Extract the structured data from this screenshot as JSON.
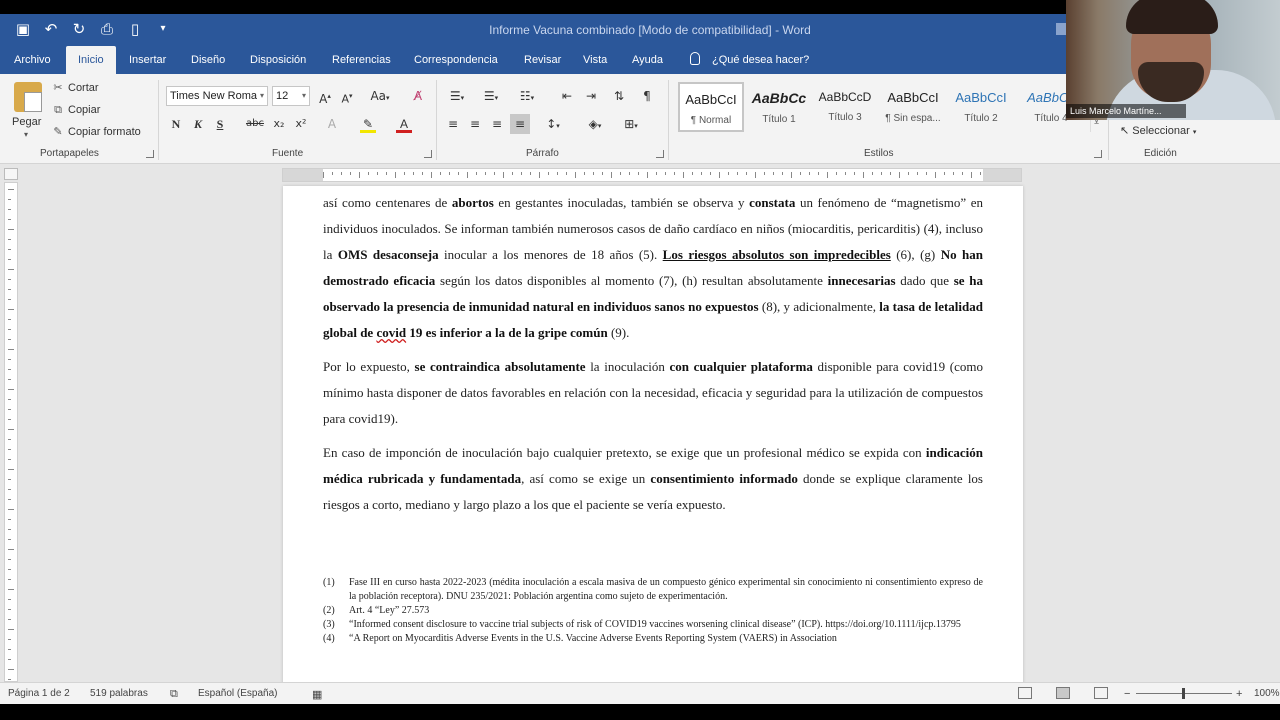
{
  "title_bar": {
    "document_title": "Informe Vacuna combinado [Modo de compatibilidad] - Word"
  },
  "quick_access": [
    "save-icon",
    "undo-icon",
    "redo-icon",
    "print-preview-icon",
    "new-document-icon",
    "customize-caret-icon"
  ],
  "tabs": [
    {
      "label": "Archivo"
    },
    {
      "label": "Inicio",
      "active": true
    },
    {
      "label": "Insertar"
    },
    {
      "label": "Diseño"
    },
    {
      "label": "Disposición"
    },
    {
      "label": "Referencias"
    },
    {
      "label": "Correspondencia"
    },
    {
      "label": "Revisar"
    },
    {
      "label": "Vista"
    },
    {
      "label": "Ayuda"
    }
  ],
  "tell_me": "¿Qué desea hacer?",
  "clipboard": {
    "paste": "Pegar",
    "cut": "Cortar",
    "copy": "Copiar",
    "format_painter": "Copiar formato",
    "group": "Portapapeles"
  },
  "font": {
    "name": "Times New Roma",
    "size": "12",
    "group": "Fuente",
    "bold": "N",
    "italic": "K",
    "underline": "S",
    "strike": "abc",
    "subscript": "x₂",
    "superscript": "x²",
    "change_case": "Aa",
    "highlight_color": "#f2e600",
    "font_color": "#d02020"
  },
  "paragraph": {
    "group": "Párrafo"
  },
  "styles": {
    "group": "Estilos",
    "items": [
      {
        "preview": "AaBbCcI",
        "name": "¶ Normal",
        "selected": true
      },
      {
        "preview": "AaBbCc",
        "name": "Título 1"
      },
      {
        "preview": "AaBbCcD",
        "name": "Título 3"
      },
      {
        "preview": "AaBbCcI",
        "name": "¶ Sin espa..."
      },
      {
        "preview": "AaBbCcI",
        "name": "Título 2"
      },
      {
        "preview": "AaBbCc",
        "name": "Título 4"
      }
    ]
  },
  "editing": {
    "select": "Seleccionar",
    "group": "Edición"
  },
  "document": {
    "p1_text1": "así como centenares de ",
    "p1_b1": "abortos",
    "p1_text2": " en gestantes inoculadas, también se observa y ",
    "p1_b2": "constata",
    "p1_text3": " un fenómeno de “magnetismo” en individuos inoculados. Se informan también numerosos casos de daño cardíaco en niños (miocarditis, pericarditis) (4), incluso la ",
    "p1_b3": "OMS desaconseja",
    "p1_text4": " inocular a los menores de 18 años (5). ",
    "p1_bu1": "Los riesgos absolutos son impredecibles",
    "p1_text5": " (6), (g) ",
    "p1_b4": "No han demostrado eficacia",
    "p1_text6": " según los datos disponibles al momento (7), (h) resultan absolutamente ",
    "p1_b5": "innecesarias",
    "p1_text7": " dado que ",
    "p1_b6": "se ha observado la presencia de inmunidad natural en individuos sanos no expuestos",
    "p1_text8": " (8), y adicionalmente, ",
    "p1_b7a": "la tasa de letalidad global de ",
    "p1_b7err": "covid",
    "p1_b7b": " 19 es inferior a la de la gripe común",
    "p1_text9": " (9).",
    "p2_text1": "Por lo expuesto, ",
    "p2_b1": "se contraindica absolutamente",
    "p2_text2": " la inoculación ",
    "p2_b2": "con cualquier plataforma",
    "p2_text3": " disponible para covid19 (como mínimo hasta disponer de datos favorables en relación con la necesidad, eficacia y seguridad para la utilización de compuestos para covid19).",
    "p3_text1": "En caso de imponción de inoculación bajo cualquier pretexto, se exige que un profesional médico se expida con ",
    "p3_b1": "indicación médica rubricada y fundamentada",
    "p3_text2": ", así como se exige un ",
    "p3_b2": "consentimiento informado",
    "p3_text3": " donde se explique claramente los riesgos a corto, mediano y largo plazo a los que el paciente se vería expuesto.",
    "refs": [
      {
        "num": "(1)",
        "text": "Fase III en curso hasta 2022-2023 (médita inoculación a escala masiva de un compuesto génico experimental sin conocimiento ni consentimiento expreso de la población receptora). DNU 235/2021: Población argentina como sujeto de experimentación."
      },
      {
        "num": "(2)",
        "text": "Art. 4 “Ley” 27.573"
      },
      {
        "num": "(3)",
        "text": "“Informed consent disclosure to vaccine trial subjects of risk of COVID19 vaccines worsening clinical disease” (ICP). https://doi.org/10.1111/ijcp.13795"
      },
      {
        "num": "(4)",
        "text": "“A Report on Myocarditis Adverse Events in the U.S. Vaccine Adverse Events Reporting System (VAERS) in Association"
      }
    ]
  },
  "status": {
    "page": "Página 1 de 2",
    "words": "519 palabras",
    "language": "Español (España)",
    "zoom": "100%",
    "zoom_value": 100
  },
  "video": {
    "participant_name": "Luis Marcelo Martíne..."
  }
}
